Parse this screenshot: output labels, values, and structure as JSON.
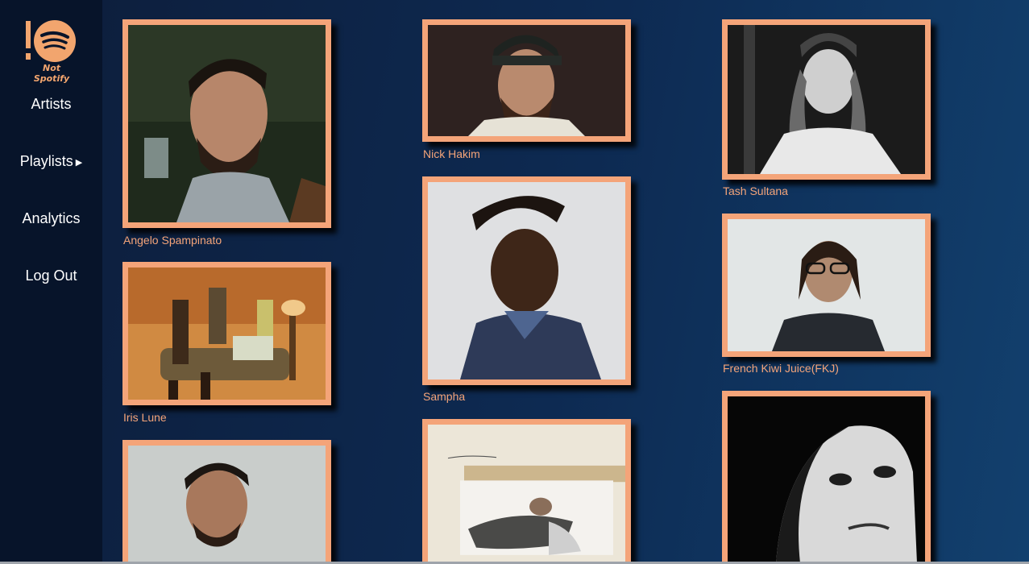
{
  "app": {
    "logo_text": "Not Spotify"
  },
  "sidebar": {
    "items": [
      {
        "label": "Artists"
      },
      {
        "label": "Playlists",
        "has_submenu": true
      },
      {
        "label": "Analytics"
      },
      {
        "label": "Log Out"
      }
    ]
  },
  "artists": [
    {
      "name": "Angelo Spampinato"
    },
    {
      "name": "Iris Lune"
    },
    {
      "name": ""
    },
    {
      "name": "Nick Hakim"
    },
    {
      "name": "Sampha"
    },
    {
      "name": ""
    },
    {
      "name": "Tash Sultana"
    },
    {
      "name": "French Kiwi Juice(FKJ)"
    },
    {
      "name": ""
    }
  ],
  "colors": {
    "accent": "#f4a479",
    "sidebar_bg": "#07142a",
    "background": "#0d2a52"
  }
}
